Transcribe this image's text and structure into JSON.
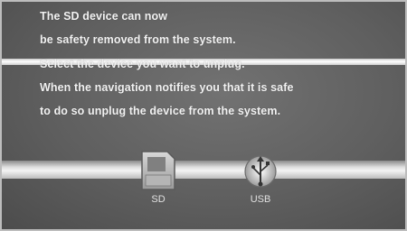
{
  "message": {
    "lines": [
      "The SD device can now",
      "be safety removed from the system.",
      "Select the device you want to unplug.",
      "When the navigation notifies you that it is safe",
      "to do so unplug the device from the system."
    ]
  },
  "devices": [
    {
      "label": "SD",
      "icon": "sd-card-icon"
    },
    {
      "label": "USB",
      "icon": "usb-icon"
    }
  ],
  "colors": {
    "background": "#606060",
    "text": "#f2f2f2",
    "bar": "#e6e6e6"
  }
}
